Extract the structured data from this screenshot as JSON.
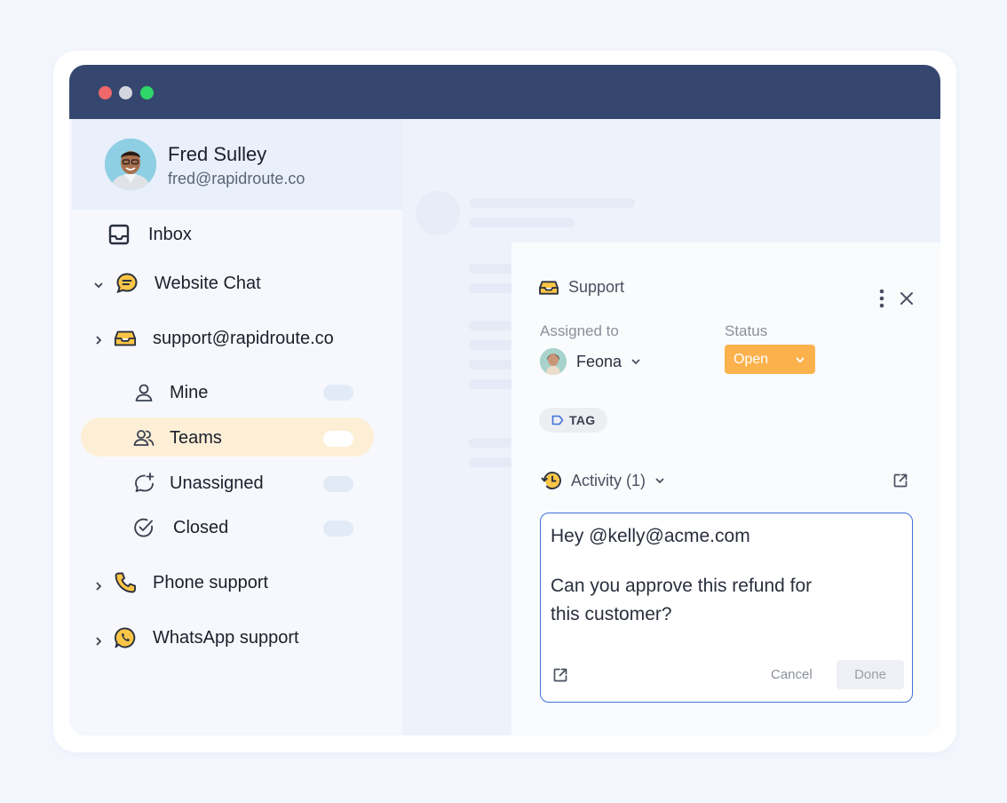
{
  "profile": {
    "name": "Fred Sulley",
    "email": "fred@rapidroute.co"
  },
  "sidebar": {
    "inbox": {
      "label": "Inbox",
      "icon": "inbox-icon"
    },
    "website_chat": {
      "label": "Website Chat",
      "icon": "chat-bubble-icon"
    },
    "support_email": {
      "label": "support@rapidroute.co",
      "icon": "inbox-tray-icon"
    },
    "sub_items": [
      {
        "label": "Mine",
        "icon": "user-icon"
      },
      {
        "label": "Teams",
        "icon": "users-icon",
        "selected": true
      },
      {
        "label": "Unassigned",
        "icon": "chat-plus-icon"
      },
      {
        "label": "Closed",
        "icon": "check-circle-icon"
      }
    ],
    "phone_support": {
      "label": "Phone support",
      "icon": "phone-icon"
    },
    "whatsapp_support": {
      "label": "WhatsApp support",
      "icon": "whatsapp-icon"
    }
  },
  "panel": {
    "title": "Support",
    "assigned_label": "Assigned to",
    "assignee": "Feona",
    "status_label": "Status",
    "status_value": "Open",
    "tag_label": "TAG",
    "activity_label": "Activity (1)",
    "message_line1": "Hey @kelly@acme.com",
    "message_line2": "Can you approve this refund for",
    "message_line3": "this customer?",
    "cancel_label": "Cancel",
    "done_label": "Done"
  },
  "colors": {
    "titlebar": "#36476f",
    "accent_orange": "#fbb24d",
    "selected_item": "#fdefd5",
    "composer_border": "#3d73d6"
  }
}
